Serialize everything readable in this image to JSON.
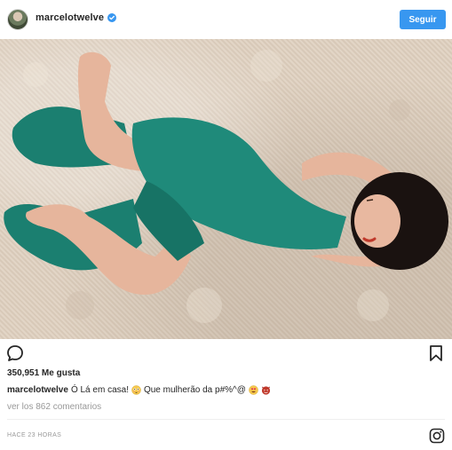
{
  "header": {
    "username": "marcelotwelve",
    "follow_label": "Seguir",
    "avatar_icon": "profile-avatar",
    "verified_icon": "verified-badge-icon"
  },
  "photo": {
    "subject": "woman-in-teal-dress-lying-on-rug",
    "dress_color": "#1f8a7a",
    "rug_color": "#ddd0c0",
    "hair_color": "#1a1210",
    "skin_color": "#e8b8a0"
  },
  "actions": {
    "comment_icon": "comment-bubble-icon",
    "bookmark_icon": "bookmark-icon"
  },
  "likes_text": "350,951 Me gusta",
  "caption": {
    "username": "marcelotwelve",
    "text_part1": "Ó Lá em casa!",
    "text_part2": "Que mulherão da p#%^@",
    "emojis": [
      "flushed-face-emoji",
      "heart-eyes-emoji",
      "devil-face-emoji"
    ]
  },
  "view_comments": "ver los 862 comentarios",
  "timestamp": "HACE 23 HORAS",
  "footer_icon": "instagram-logo-icon",
  "colors": {
    "accent": "#3897f0",
    "text": "#262626",
    "muted": "#999999",
    "divider": "#efefef"
  }
}
